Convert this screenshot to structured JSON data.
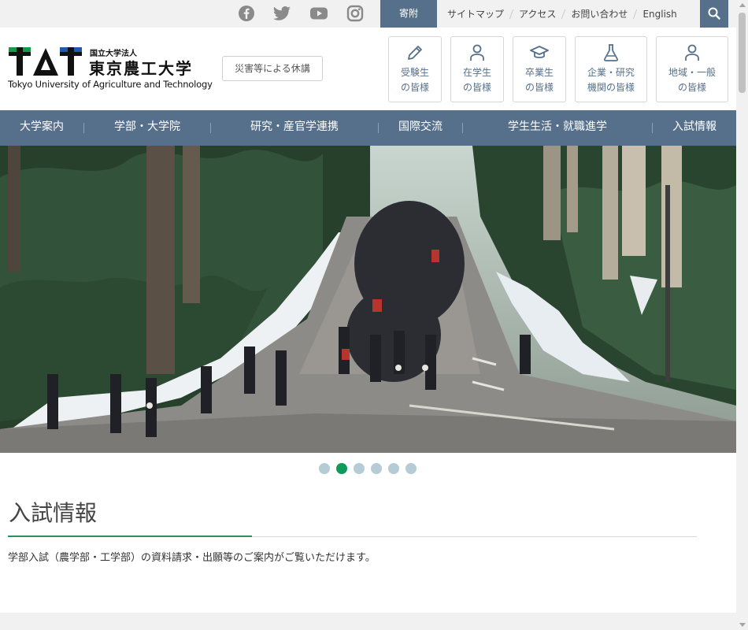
{
  "social": [
    {
      "icon": "facebook-icon"
    },
    {
      "icon": "twitter-icon"
    },
    {
      "icon": "youtube-icon"
    },
    {
      "icon": "instagram-icon"
    }
  ],
  "topbar": {
    "donation": "寄附",
    "links": [
      "サイトマップ",
      "アクセス",
      "お問い合わせ",
      "English"
    ],
    "search_icon": "search-icon"
  },
  "logo": {
    "mark": "TAT",
    "subtitle": "国立大学法人",
    "name": "東京農工大学",
    "english": "Tokyo University of Agriculture and Technology"
  },
  "disaster_button": "災害等による休講",
  "targets": [
    {
      "line1": "受験生",
      "line2": "の皆様",
      "icon": "pencil-icon"
    },
    {
      "line1": "在学生",
      "line2": "の皆様",
      "icon": "person-icon"
    },
    {
      "line1": "卒業生",
      "line2": "の皆様",
      "icon": "graduation-cap-icon"
    },
    {
      "line1": "企業・研究",
      "line2": "機関の皆様",
      "icon": "flask-icon"
    },
    {
      "line1": "地域・一般",
      "line2": "の皆様",
      "icon": "person-icon"
    }
  ],
  "nav": [
    "大学案内",
    "学部・大学院",
    "研究・産官学連携",
    "国際交流",
    "学生生活・就職進学",
    "入試情報"
  ],
  "slider": {
    "count": 6,
    "active": 2
  },
  "section": {
    "title": "入試情報",
    "text": "学部入試（農学部・工学部）の資料請求・出願等のご案内がご覧いただけます。"
  },
  "colors": {
    "nav": "#56708b",
    "accent": "#0f9a5a",
    "logo_green": "#159a4c",
    "logo_blue": "#1f5aa8"
  }
}
